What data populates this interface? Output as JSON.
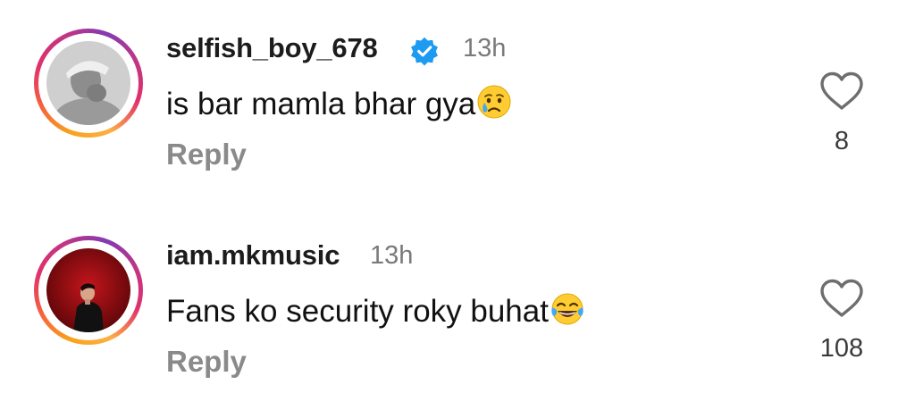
{
  "colors": {
    "username": "#1c1c1c",
    "timestamp": "#7a7a7a",
    "reply": "#8a8a8a",
    "verified_badge": "#1d9bf0",
    "story_ring": [
      "#f9a21b",
      "#e1306c",
      "#833ab4"
    ]
  },
  "comments": [
    {
      "username": "selfish_boy_678",
      "verified": true,
      "time": "13h",
      "text": "is bar mamla bhar gya",
      "emoji": "crying-face",
      "reply_label": "Reply",
      "likes": "8",
      "icons": [
        "avatar",
        "verified-badge-icon",
        "crying-face-icon",
        "heart-icon"
      ]
    },
    {
      "username": "iam.mkmusic",
      "verified": false,
      "time": "13h",
      "text": "Fans ko security roky buhat",
      "emoji": "tears-of-joy",
      "reply_label": "Reply",
      "likes": "108",
      "icons": [
        "avatar",
        "tears-of-joy-icon",
        "heart-icon"
      ]
    }
  ]
}
